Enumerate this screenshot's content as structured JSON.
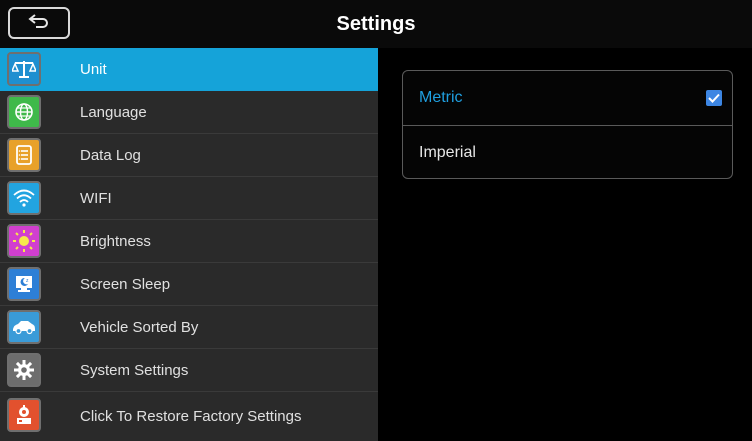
{
  "header": {
    "title": "Settings",
    "back_icon": "back-arrow-icon"
  },
  "sidebar": {
    "items": [
      {
        "label": "Unit",
        "icon": "scale-icon",
        "color": "#1f8fd0",
        "active": true
      },
      {
        "label": "Language",
        "icon": "globe-icon",
        "color": "#3fb94a",
        "active": false
      },
      {
        "label": "Data Log",
        "icon": "list-icon",
        "color": "#e8a12a",
        "active": false
      },
      {
        "label": "WIFI",
        "icon": "wifi-icon",
        "color": "#22a4e0",
        "active": false
      },
      {
        "label": "Brightness",
        "icon": "sun-icon",
        "color": "#d13fcf",
        "active": false
      },
      {
        "label": "Screen Sleep",
        "icon": "monitor-sleep-icon",
        "color": "#2d7fd6",
        "active": false
      },
      {
        "label": "Vehicle Sorted By",
        "icon": "car-icon",
        "color": "#3a9bd8",
        "active": false
      },
      {
        "label": "System Settings",
        "icon": "gear-icon",
        "color": "#6d6d6d",
        "active": false
      },
      {
        "label": "Click To Restore Factory Settings",
        "icon": "factory-reset-icon",
        "color": "#e2512e",
        "active": false
      }
    ]
  },
  "unit_options": [
    {
      "label": "Metric",
      "selected": true
    },
    {
      "label": "Imperial",
      "selected": false
    }
  ],
  "colors": {
    "accent": "#15a3d9",
    "selected_text": "#1f9fe0",
    "checkbox": "#3d86e3"
  }
}
